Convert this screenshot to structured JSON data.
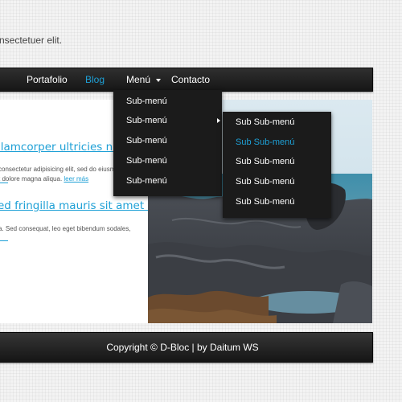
{
  "header": {
    "tagline": "nsectetuer elit."
  },
  "nav": {
    "items": [
      {
        "label": "Portafolio"
      },
      {
        "label": "Blog"
      },
      {
        "label": "Menú"
      },
      {
        "label": "Contacto"
      }
    ],
    "active": "Blog"
  },
  "dropdown": {
    "items": [
      "Sub-menú",
      "Sub-menú",
      "Sub-menú",
      "Sub-menú",
      "Sub-menú"
    ]
  },
  "subdropdown": {
    "items": [
      "Sub Sub-menú",
      "Sub Sub-menú",
      "Sub Sub-menú",
      "Sub Sub-menú",
      "Sub Sub-menú"
    ],
    "active_index": 1
  },
  "posts": [
    {
      "title": "llamcorper ultricies nisi",
      "text_line1": "consectetur adipisicing elit, sed do eiusm",
      "text_line2": "t dolore magna aliqua.",
      "read_more": "leer más"
    },
    {
      "title": "ed fringilla mauris sit amet nibh",
      "text_line1": "a. Sed consequat, leo eget bibendum sodales,"
    }
  ],
  "footer": {
    "text": "Copyright © D-Bloc | by Daitum WS"
  },
  "colors": {
    "accent": "#1ea0d6",
    "bar": "#1b1b1b"
  }
}
